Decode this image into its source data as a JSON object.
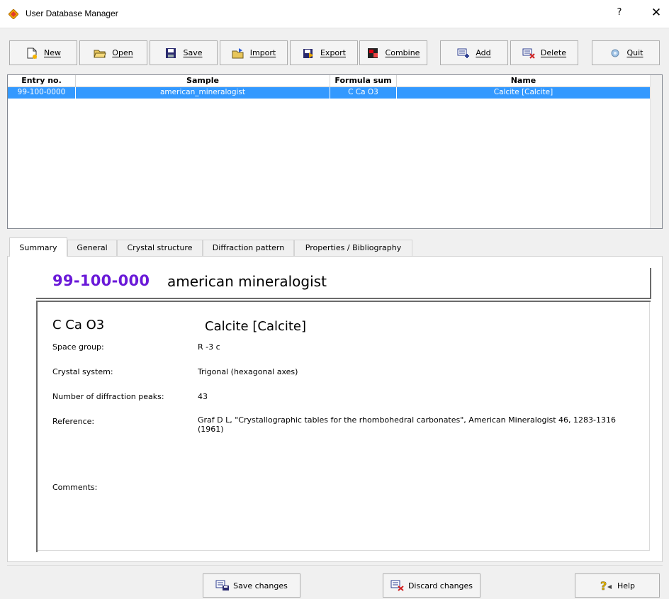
{
  "window": {
    "title": "User Database Manager",
    "help_glyph": "?",
    "close_glyph": "✕"
  },
  "toolbar": {
    "new_label": "New",
    "open_label": "Open",
    "save_label": "Save",
    "import_label": "Import",
    "export_label": "Export",
    "combine_label": "Combine",
    "add_label": "Add",
    "delete_label": "Delete",
    "quit_label": "Quit"
  },
  "table": {
    "columns": [
      "Entry no.",
      "Sample",
      "Formula sum",
      "Name"
    ],
    "rows": [
      {
        "entry_no": "99-100-0000",
        "sample": "american_mineralogist",
        "formula_sum": "C Ca O3",
        "name": "Calcite [Calcite]"
      }
    ]
  },
  "tabs": [
    "Summary",
    "General",
    "Crystal structure",
    "Diffraction pattern",
    "Properties / Bibliography"
  ],
  "summary": {
    "entry_no": "99-100-000",
    "sample": "american  mineralogist",
    "formula": "C Ca O3",
    "name": "Calcite [Calcite]",
    "space_group_label": "Space group:",
    "space_group": "R -3 c",
    "crystal_system_label": "Crystal system:",
    "crystal_system": "Trigonal (hexagonal axes)",
    "peaks_label": "Number of diffraction peaks:",
    "peaks": "43",
    "reference_label": "Reference:",
    "reference_line1": "Graf D L, \"Crystallographic tables for the rhombohedral carbonates\", American Mineralogist 46, 1283-1316",
    "reference_line2": "(1961)",
    "comments_label": "Comments:",
    "comments": ""
  },
  "bottom": {
    "save_changes_label": "Save changes",
    "discard_changes_label": "Discard changes",
    "help_label": "Help"
  },
  "colors": {
    "selection": "#3399ff",
    "entry_no": "#6a19d8"
  }
}
